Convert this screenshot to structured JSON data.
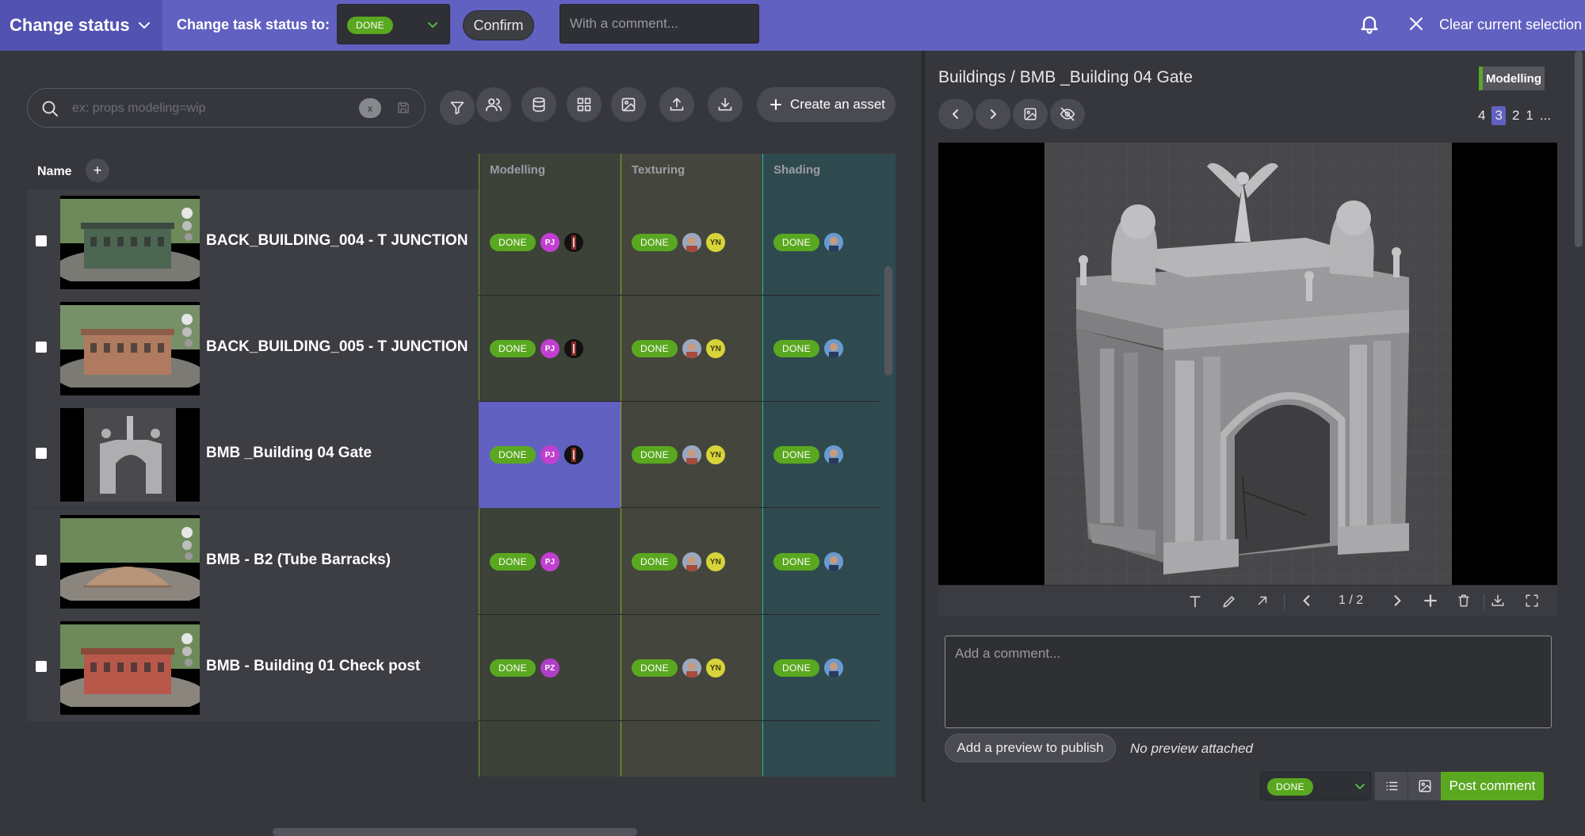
{
  "topbar": {
    "mode_title": "Change status",
    "change_label": "Change task status to:",
    "status_value": "DONE",
    "confirm_label": "Confirm",
    "comment_placeholder": "With a comment...",
    "clear_label": "Clear current selection"
  },
  "toolbar": {
    "search_placeholder": "ex: props modeling=wip",
    "search_clear": "x",
    "create_label": "Create an asset",
    "buttons": [
      "filter-icon",
      "people-icon",
      "database-icon",
      "grid-icon",
      "image-icon",
      "upload-icon",
      "download-icon"
    ]
  },
  "table": {
    "name_header": "Name",
    "add_header": "+",
    "columns": [
      {
        "label": "Modelling",
        "color": "#6c9c2c"
      },
      {
        "label": "Texturing",
        "color": "#9ca42c"
      },
      {
        "label": "Shading",
        "color": "#2cb4b4"
      }
    ],
    "rows": [
      {
        "name": "",
        "partial": true,
        "modelling": {
          "status": "DONE",
          "assignees": [
            "PJ",
            "dark"
          ]
        },
        "texturing": {
          "status": "DONE",
          "assignees": [
            "ph",
            "YN"
          ]
        },
        "shading": {
          "status": "DONE",
          "assignees": [
            "sh"
          ]
        }
      },
      {
        "name": "BACK_BUILDING_004 - T JUNCTION",
        "modelling": {
          "status": "DONE",
          "assignees": [
            "PJ",
            "dark"
          ]
        },
        "texturing": {
          "status": "DONE",
          "assignees": [
            "ph",
            "YN"
          ]
        },
        "shading": {
          "status": "DONE",
          "assignees": [
            "sh"
          ]
        }
      },
      {
        "name": "BACK_BUILDING_005 - T JUNCTION",
        "modelling": {
          "status": "DONE",
          "assignees": [
            "PJ",
            "dark"
          ]
        },
        "texturing": {
          "status": "DONE",
          "assignees": [
            "ph",
            "YN"
          ]
        },
        "shading": {
          "status": "DONE",
          "assignees": [
            "sh"
          ]
        }
      },
      {
        "name": "BMB _Building 04 Gate",
        "selected": true,
        "modelling": {
          "status": "DONE",
          "assignees": [
            "PJ",
            "dark"
          ]
        },
        "texturing": {
          "status": "DONE",
          "assignees": [
            "ph",
            "YN"
          ]
        },
        "shading": {
          "status": "DONE",
          "assignees": [
            "sh"
          ]
        }
      },
      {
        "name": "BMB - B2 (Tube Barracks)",
        "modelling": {
          "status": "DONE",
          "assignees": [
            "PJ"
          ]
        },
        "texturing": {
          "status": "DONE",
          "assignees": [
            "ph",
            "YN"
          ]
        },
        "shading": {
          "status": "DONE",
          "assignees": [
            "sh"
          ]
        }
      },
      {
        "name": "BMB - Building 01 Check post",
        "modelling": {
          "status": "DONE",
          "assignees": [
            "PZ"
          ]
        },
        "texturing": {
          "status": "DONE",
          "assignees": [
            "ph",
            "YN"
          ]
        },
        "shading": {
          "status": "DONE",
          "assignees": [
            "sh"
          ]
        }
      }
    ]
  },
  "preview": {
    "breadcrumb": "Buildings / BMB _Building 04 Gate",
    "task_type": "Modelling",
    "revisions": [
      "4",
      "3",
      "2",
      "1",
      "..."
    ],
    "selected_revision": "3",
    "page_indicator": "1 / 2",
    "comment_placeholder": "Add a comment...",
    "add_preview_label": "Add a preview to publish",
    "no_preview_label": "No preview attached",
    "post_status": "DONE",
    "post_label": "Post comment"
  },
  "colors": {
    "topbar": "#6161c1",
    "accent": "#6161c1",
    "done": "#5aa820",
    "panel": "#36373d"
  }
}
